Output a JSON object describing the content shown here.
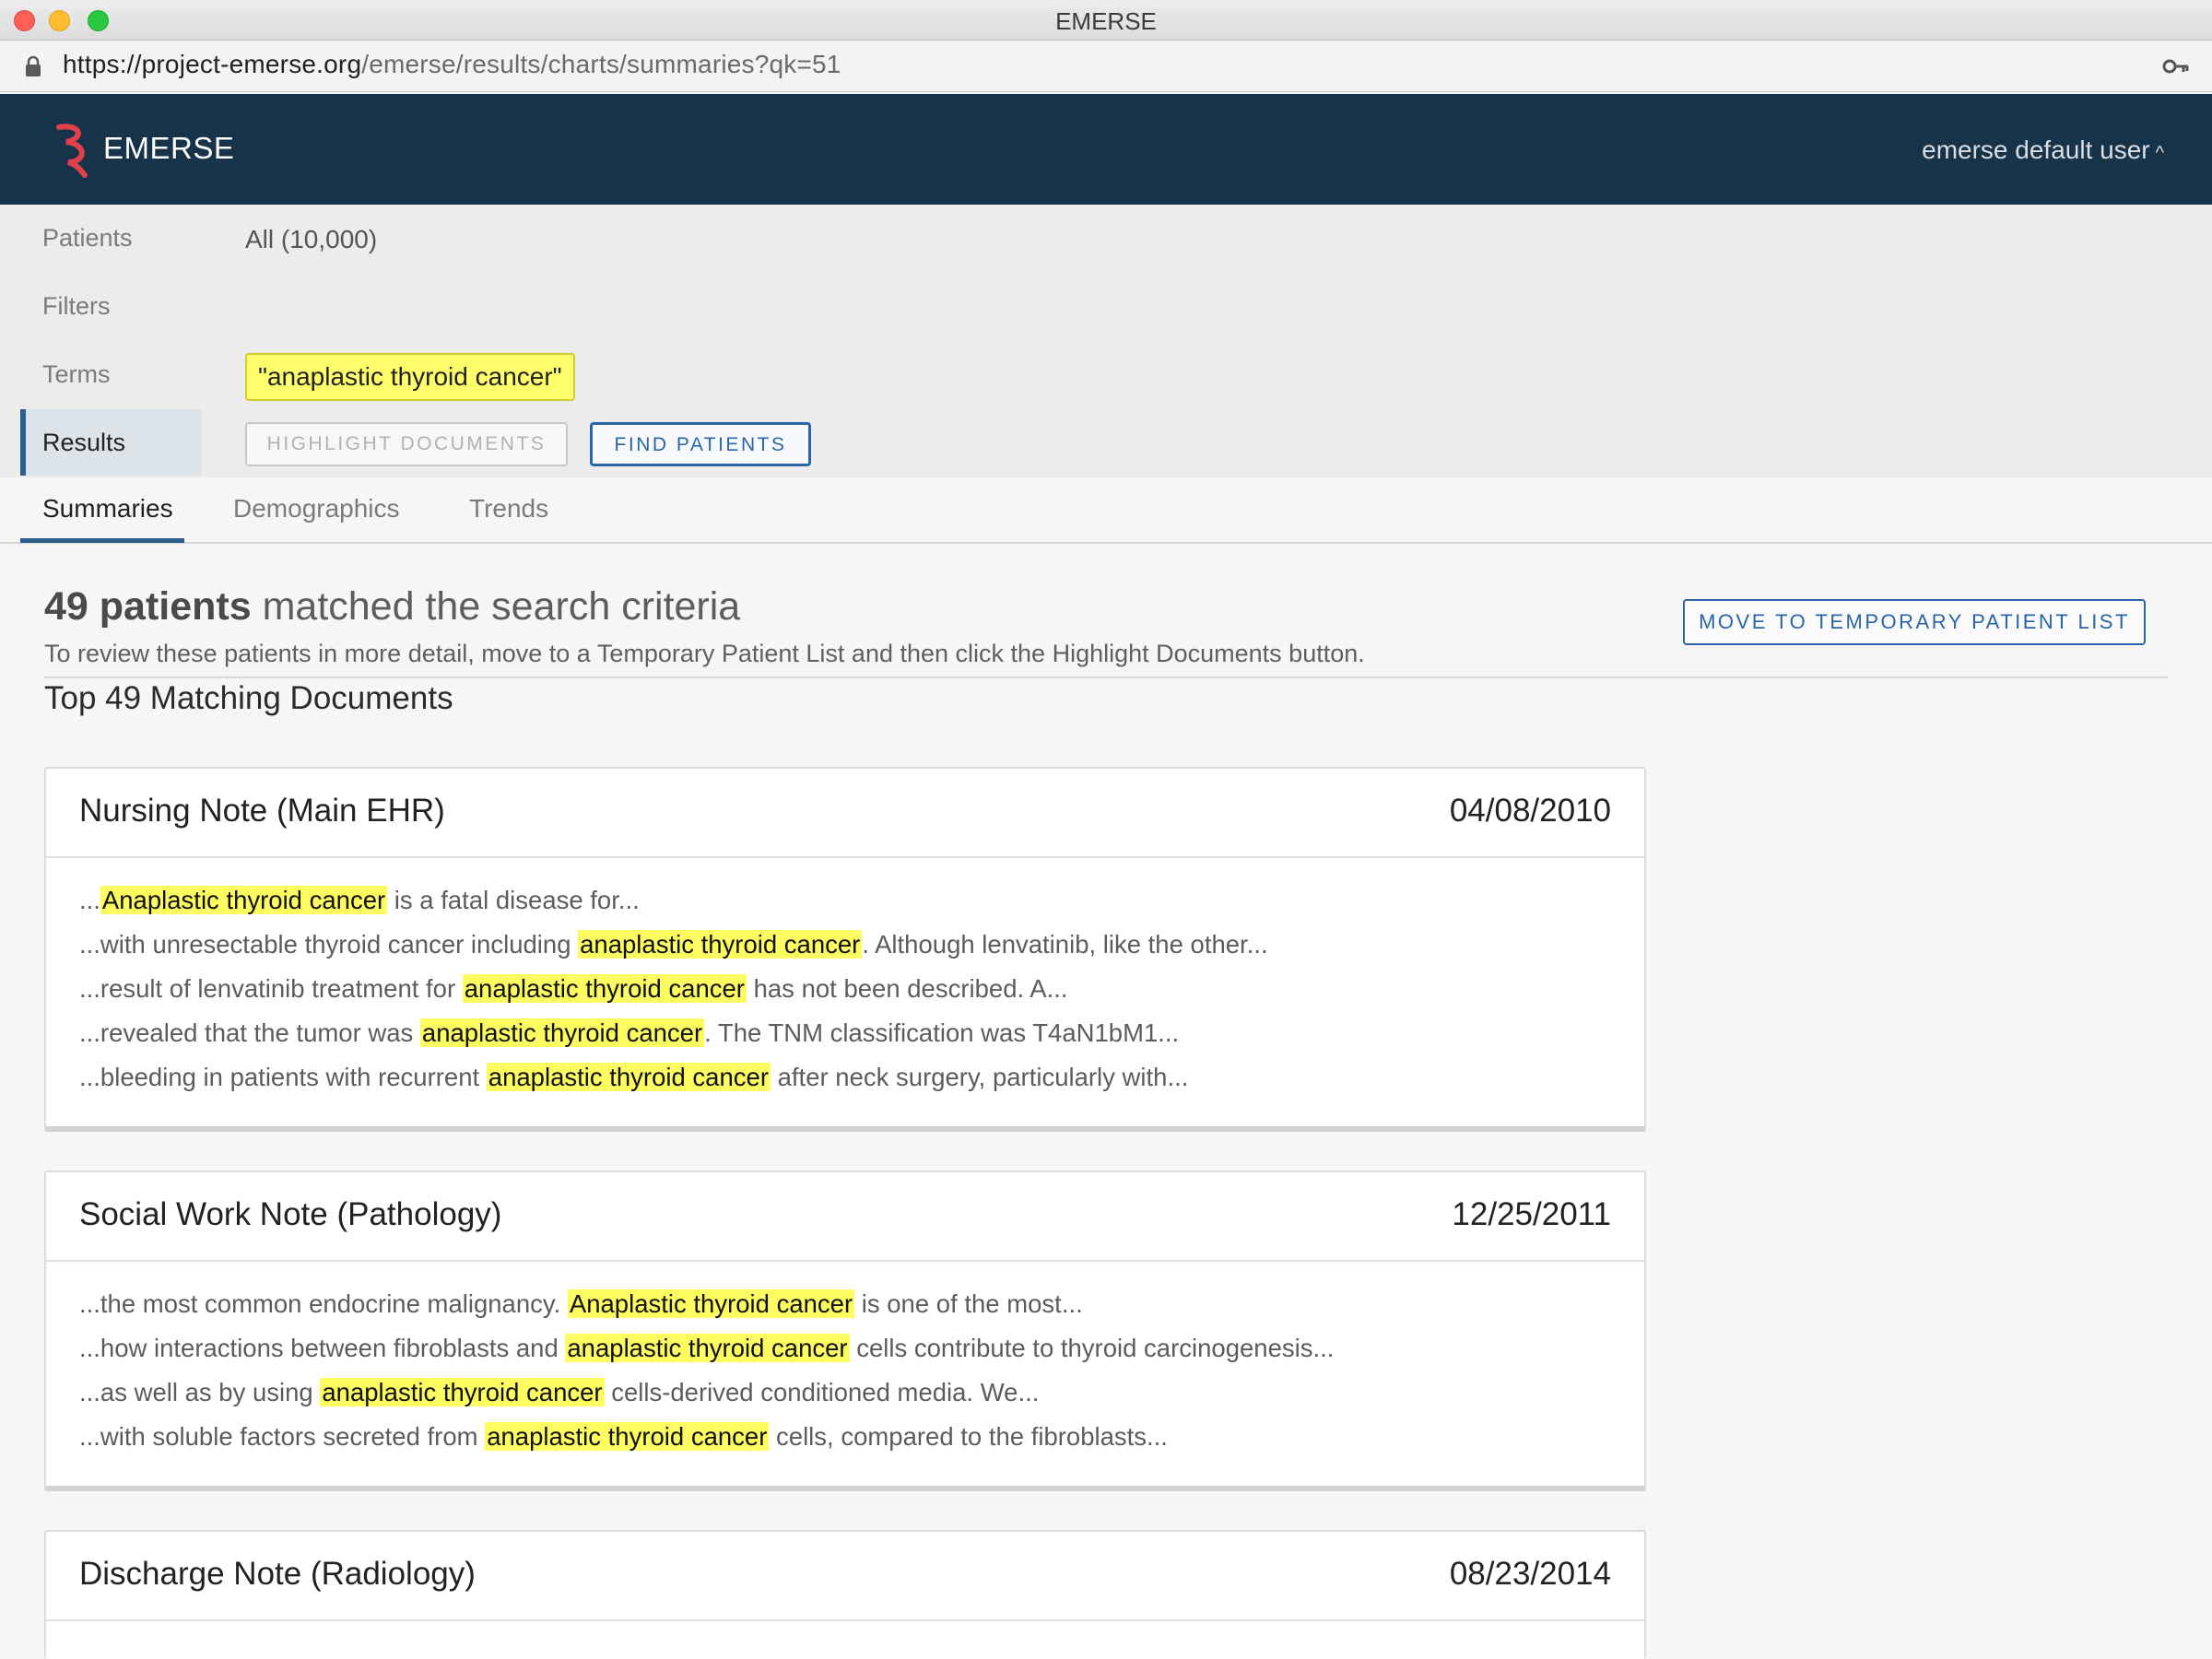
{
  "window": {
    "title": "EMERSE",
    "url_host": "https://project-emerse.org",
    "url_path": "/emerse/results/charts/summaries?qk=51"
  },
  "header": {
    "app_name": "EMERSE",
    "user_label": "emerse default user",
    "user_chevron": "^",
    "colors": {
      "bar": "#163349",
      "logo": "#e0404a"
    }
  },
  "query": {
    "patients_label": "Patients",
    "patients_value": "All (10,000)",
    "filters_label": "Filters",
    "terms_label": "Terms",
    "term_chip": "\"anaplastic thyroid cancer\"",
    "results_label": "Results",
    "highlight_button": "HIGHLIGHT DOCUMENTS",
    "find_button": "FIND PATIENTS"
  },
  "tabs": {
    "summaries": "Summaries",
    "demographics": "Demographics",
    "trends": "Trends"
  },
  "results": {
    "count_bold": "49 patients",
    "count_rest": " matched the search criteria",
    "hint": "To review these patients in more detail, move to a Temporary Patient List and then click the Highlight Documents button.",
    "move_button": "MOVE TO TEMPORARY PATIENT LIST",
    "top_heading": "Top 49 Matching Documents"
  },
  "documents": [
    {
      "title": "Nursing Note (Main EHR)",
      "date": "04/08/2010",
      "snippets": [
        {
          "pre": "...",
          "hl": "Anaplastic thyroid cancer",
          "post": " is a fatal disease for..."
        },
        {
          "pre": "...with unresectable thyroid cancer including ",
          "hl": "anaplastic thyroid cancer",
          "post": ". Although lenvatinib, like the other..."
        },
        {
          "pre": "...result of lenvatinib treatment for ",
          "hl": "anaplastic thyroid cancer",
          "post": " has not been described. A..."
        },
        {
          "pre": "...revealed that the tumor was ",
          "hl": "anaplastic thyroid cancer",
          "post": ". The TNM classification was T4aN1bM1..."
        },
        {
          "pre": "...bleeding in patients with recurrent ",
          "hl": "anaplastic thyroid cancer",
          "post": " after neck surgery, particularly with..."
        }
      ]
    },
    {
      "title": "Social Work Note (Pathology)",
      "date": "12/25/2011",
      "snippets": [
        {
          "pre": "...the most common endocrine malignancy. ",
          "hl": "Anaplastic thyroid cancer",
          "post": " is one of the most..."
        },
        {
          "pre": "...how interactions between fibroblasts and ",
          "hl": "anaplastic thyroid cancer",
          "post": " cells contribute to thyroid carcinogenesis..."
        },
        {
          "pre": "...as well as by using ",
          "hl": "anaplastic thyroid cancer",
          "post": " cells-derived conditioned media. We..."
        },
        {
          "pre": "...with soluble factors secreted from ",
          "hl": "anaplastic thyroid cancer",
          "post": " cells, compared to the fibroblasts..."
        }
      ]
    },
    {
      "title": "Discharge Note (Radiology)",
      "date": "08/23/2014",
      "snippets": []
    }
  ]
}
